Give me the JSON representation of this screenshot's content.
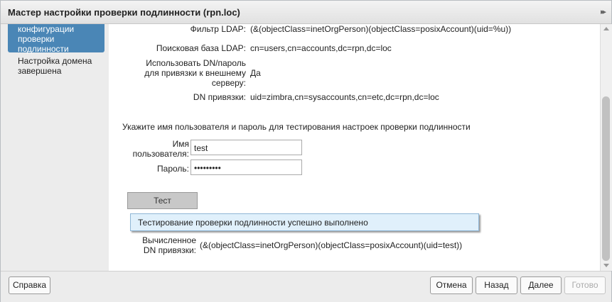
{
  "window": {
    "title": "Мастер настройки проверки подлинности (rpn.loc)"
  },
  "sidebar": {
    "items": [
      {
        "label": "конфигурации проверки подлинности"
      },
      {
        "label": "Настройка домена завершена"
      }
    ]
  },
  "settings": [
    {
      "label": "Фильтр LDAP:",
      "value": "(&(objectClass=inetOrgPerson)(objectClass=posixAccount)(uid=%u))"
    },
    {
      "label": "Поисковая база LDAP:",
      "value": "cn=users,cn=accounts,dc=rpn,dc=loc"
    },
    {
      "label": "Использовать DN/пароль для привязки к внешнему серверу:",
      "value": "Да"
    },
    {
      "label": "DN привязки:",
      "value": "uid=zimbra,cn=sysaccounts,cn=etc,dc=rpn,dc=loc"
    }
  ],
  "test": {
    "instructions": "Укажите имя пользователя и пароль для тестирования настроек проверки подлинности",
    "username_label": "Имя пользователя:",
    "username_value": "test",
    "password_label": "Пароль:",
    "password_value": "•••••••••",
    "test_button": "Тест",
    "status_message": "Тестирование проверки подлинности успешно выполнено",
    "computed_dn_label": "Вычисленное DN привязки:",
    "computed_dn_value": "(&(objectClass=inetOrgPerson)(objectClass=posixAccount)(uid=test))"
  },
  "footer": {
    "help": "Справка",
    "cancel": "Отмена",
    "back": "Назад",
    "next": "Далее",
    "finish": "Готово"
  }
}
